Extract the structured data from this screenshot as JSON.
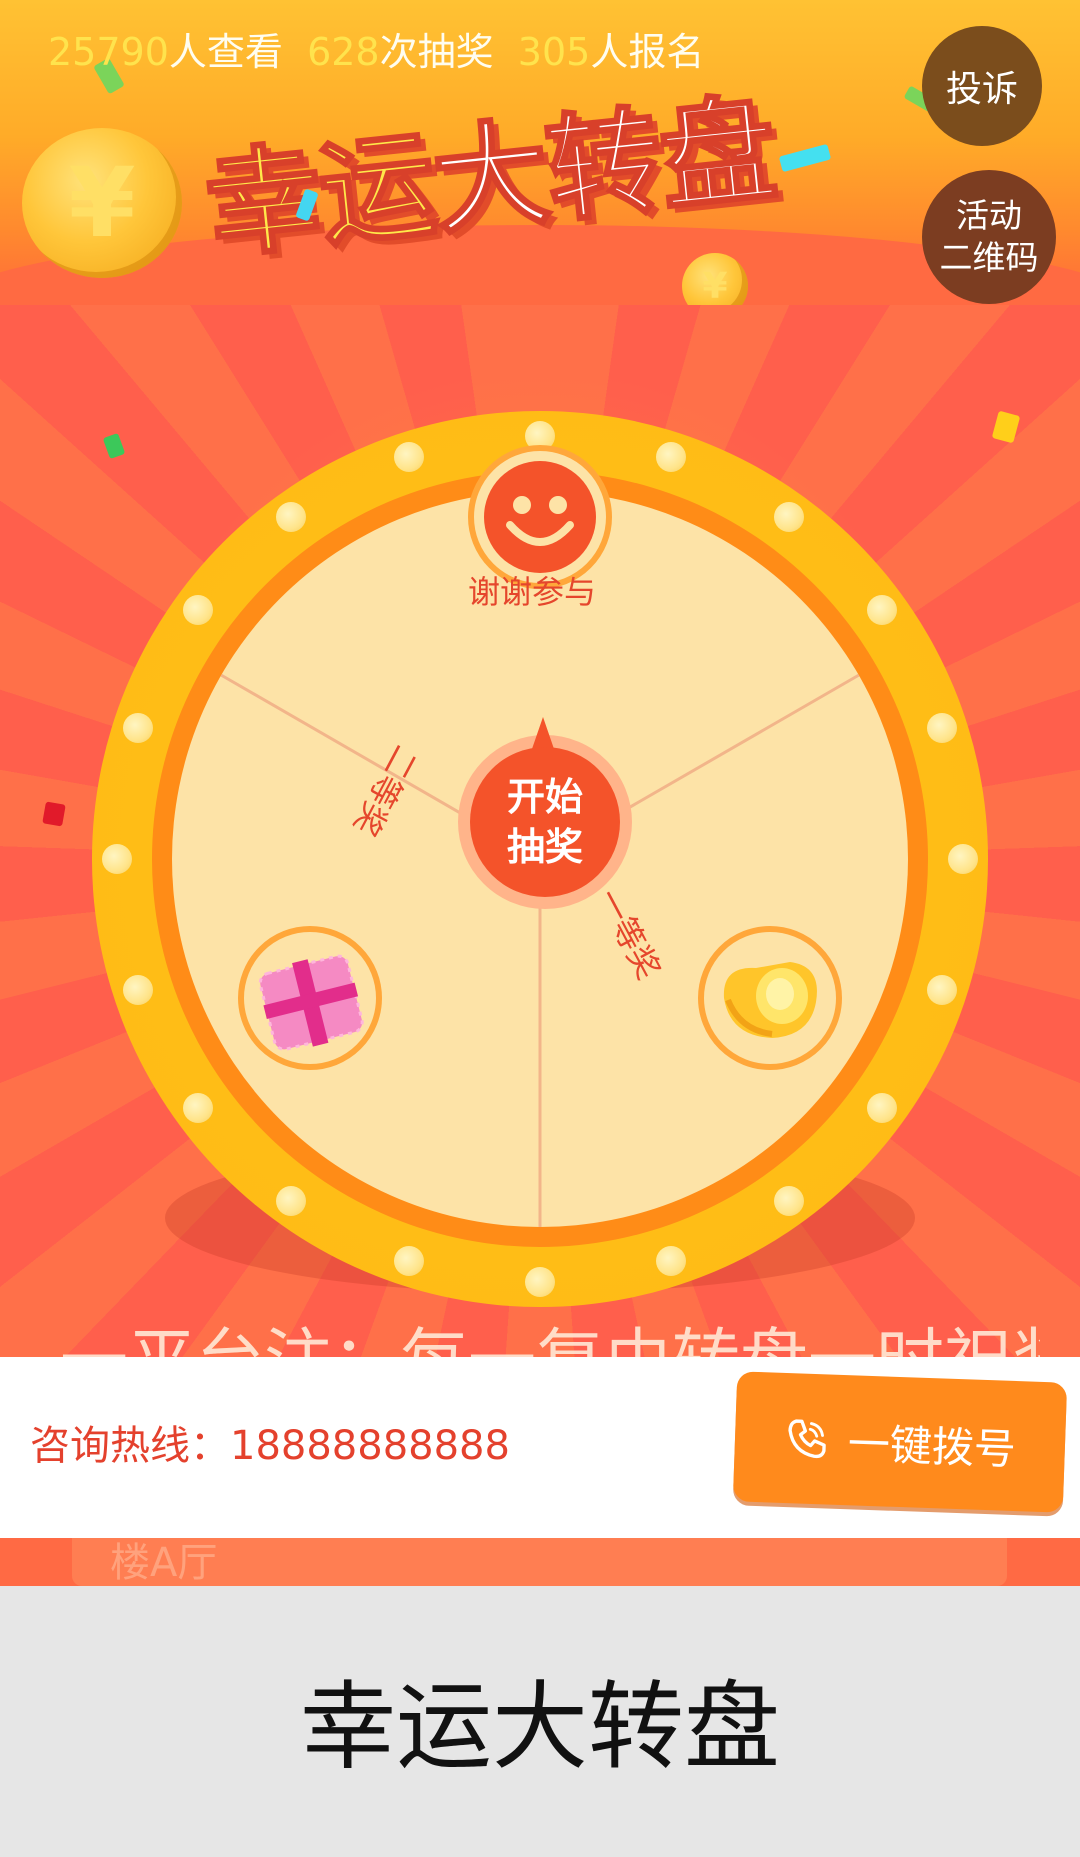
{
  "header": {
    "logo_text_part1": "幸运",
    "logo_text_part2": "大转盘",
    "coin_symbol": "¥",
    "stats": {
      "views_count": "25790",
      "views_label": "人查看",
      "draws_count": "628",
      "draws_label": "次抽奖",
      "signups_count": "305",
      "signups_label": "人报名"
    },
    "complain_button": "投诉",
    "qr_button_line1": "活动",
    "qr_button_line2": "二维码"
  },
  "wheel": {
    "prizes": [
      {
        "label": "谢谢参与",
        "icon": "smiley-face-icon"
      },
      {
        "label": "一等奖",
        "icon": "gold-ingot-icon"
      },
      {
        "label": "二等奖",
        "icon": "gift-box-icon"
      }
    ],
    "start_button_line1": "开始",
    "start_button_line2": "抽奖"
  },
  "partial_text": "一平台注：每一复由转盘一时祝奖励",
  "hall_text": "楼A厅",
  "hotline": {
    "label": "咨询热线：18888888888",
    "dial_button": "一键拨号",
    "dial_icon": "phone-icon"
  },
  "page_title": "幸运大转盘",
  "colors": {
    "banner_yellow": "#ffc233",
    "stage_red": "#ff6a42",
    "wheel_gold": "#ffbb14",
    "wheel_face": "#fde3a7",
    "accent_red": "#e4412d",
    "dial_orange": "#ff8a1c"
  }
}
